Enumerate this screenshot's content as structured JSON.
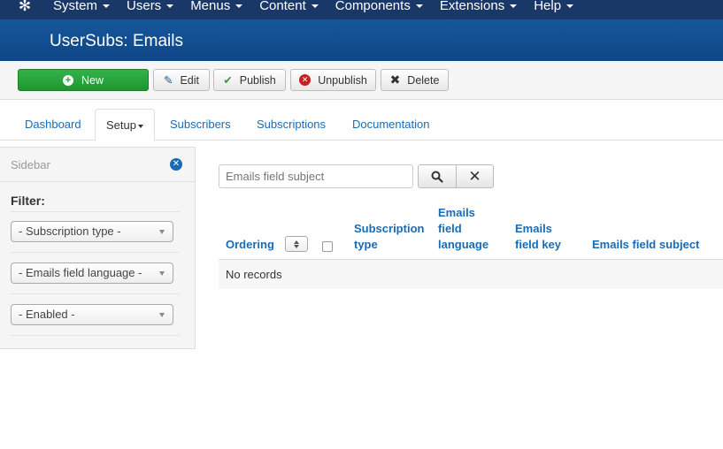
{
  "navbar": {
    "logo_icon": "joomla-logo-icon",
    "items": [
      {
        "label": "System"
      },
      {
        "label": "Users"
      },
      {
        "label": "Menus"
      },
      {
        "label": "Content"
      },
      {
        "label": "Components"
      },
      {
        "label": "Extensions"
      },
      {
        "label": "Help"
      }
    ]
  },
  "header": {
    "title": "UserSubs: Emails"
  },
  "toolbar": {
    "new_label": "New",
    "edit_label": "Edit",
    "publish_label": "Publish",
    "unpublish_label": "Unpublish",
    "delete_label": "Delete"
  },
  "tabs": {
    "dashboard": "Dashboard",
    "setup": "Setup",
    "subscribers": "Subscribers",
    "subscriptions": "Subscriptions",
    "documentation": "Documentation"
  },
  "sidebar": {
    "title": "Sidebar",
    "filter_label": "Filter:",
    "filters": {
      "subscription_type": "- Subscription type -",
      "emails_field_language": "- Emails field language -",
      "enabled": "- Enabled -"
    }
  },
  "search": {
    "placeholder": "Emails field subject",
    "clear_label": "✕"
  },
  "table": {
    "columns": {
      "ordering": "Ordering",
      "subscription_type": "Subscription type",
      "emails_field_language": "Emails field language",
      "emails_field_key": "Emails field key",
      "emails_field_subject": "Emails field subject"
    },
    "empty_text": "No records"
  },
  "colors": {
    "navbar_bg": "#1a3867",
    "header_bg": "#17569b",
    "link": "#1a6bb5",
    "new_button": "#249e36",
    "unpublish_icon": "#c52121"
  }
}
